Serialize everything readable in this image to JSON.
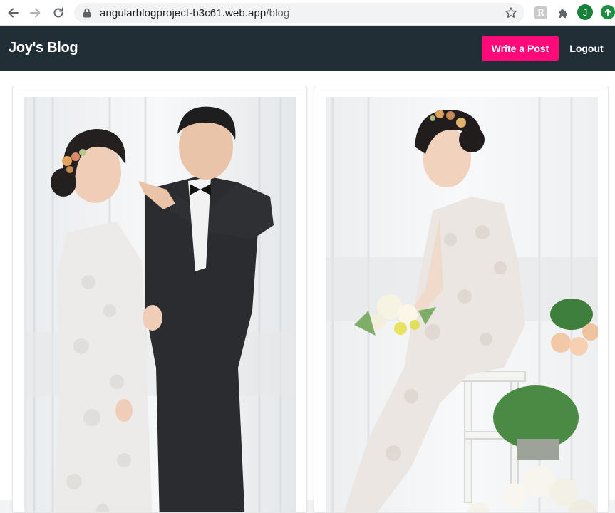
{
  "browser": {
    "url_host": "angularblogproject-b3c61.web.app",
    "url_path": "/blog",
    "profile_initial": "J",
    "extension_letter": "R"
  },
  "header": {
    "brand": "Joy's Blog",
    "write_label": "Write a Post",
    "logout_label": "Logout",
    "colors": {
      "bar": "#212e36",
      "accent": "#ff0a78"
    }
  },
  "posts": [
    {
      "image": "couple-wedding-photo"
    },
    {
      "image": "bride-seated-with-bouquet-photo"
    }
  ]
}
